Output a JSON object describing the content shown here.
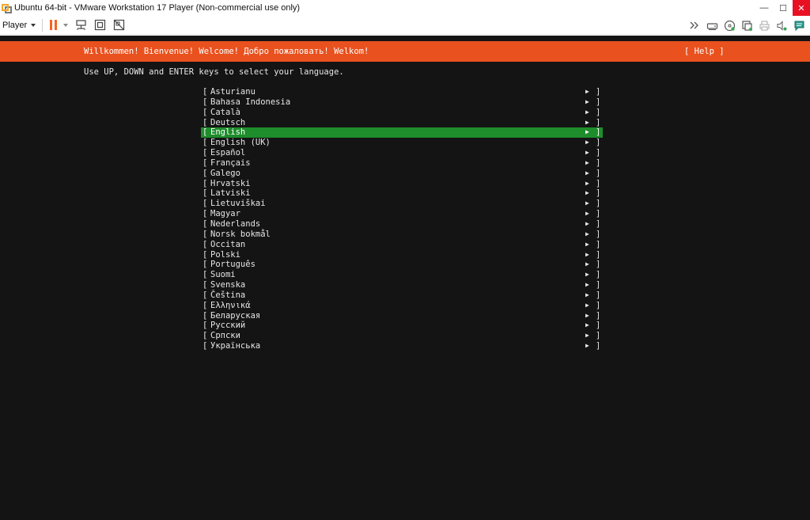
{
  "window": {
    "title": "Ubuntu 64-bit - VMware Workstation 17 Player (Non-commercial use only)",
    "minimize_glyph": "—",
    "maximize_glyph": "☐",
    "close_glyph": "✕"
  },
  "toolbar": {
    "player_label": "Player"
  },
  "installer": {
    "welcome": "Willkommen! Bienvenue! Welcome! Добро пожаловать! Welkom!",
    "help": "[ Help ]",
    "instructions": "Use UP, DOWN and ENTER keys to select your language.",
    "selected_index": 4,
    "languages": [
      "Asturianu",
      "Bahasa Indonesia",
      "Català",
      "Deutsch",
      "English",
      "English (UK)",
      "Español",
      "Français",
      "Galego",
      "Hrvatski",
      "Latviski",
      "Lietuviškai",
      "Magyar",
      "Nederlands",
      "Norsk bokmål",
      "Occitan",
      "Polski",
      "Português",
      "Suomi",
      "Svenska",
      "Čeština",
      "Ελληνικά",
      "Беларуская",
      "Русский",
      "Српски",
      "Українська"
    ]
  },
  "colors": {
    "header_orange": "#e9511e",
    "selection_green": "#1e8d2b",
    "console_bg": "#141414"
  }
}
